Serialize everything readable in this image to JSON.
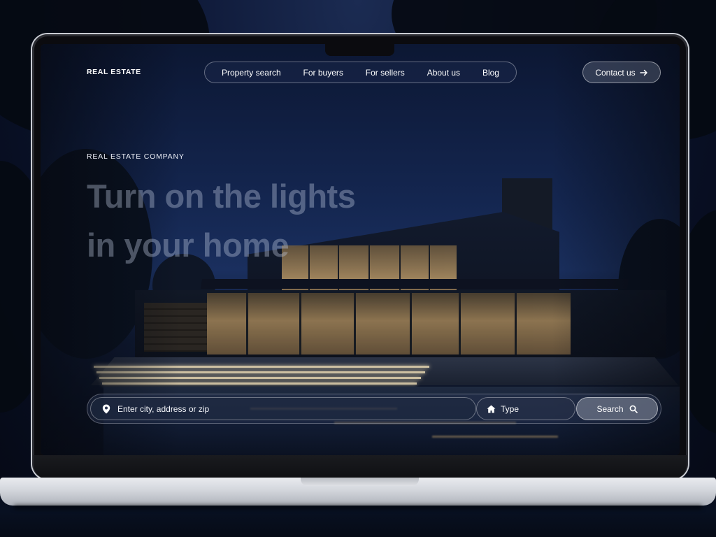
{
  "brand": {
    "logo": "REAL ESTATE"
  },
  "nav": {
    "items": [
      {
        "label": "Property search"
      },
      {
        "label": "For buyers"
      },
      {
        "label": "For sellers"
      },
      {
        "label": "About us"
      },
      {
        "label": "Blog"
      }
    ],
    "contact_label": "Contact us",
    "contact_icon": "arrow-right-icon"
  },
  "hero": {
    "kicker": "REAL ESTATE COMPANY",
    "headline_line1": "Turn on the lights",
    "headline_line2": "in your home"
  },
  "search": {
    "location_placeholder": "Enter city, address or zip",
    "location_icon": "map-pin-icon",
    "type_label": "Type",
    "type_icon": "home-icon",
    "search_label": "Search",
    "search_icon": "search-icon"
  },
  "colors": {
    "night_sky": "#142650",
    "window_glow": "#b89766",
    "text": "#ffffff"
  }
}
